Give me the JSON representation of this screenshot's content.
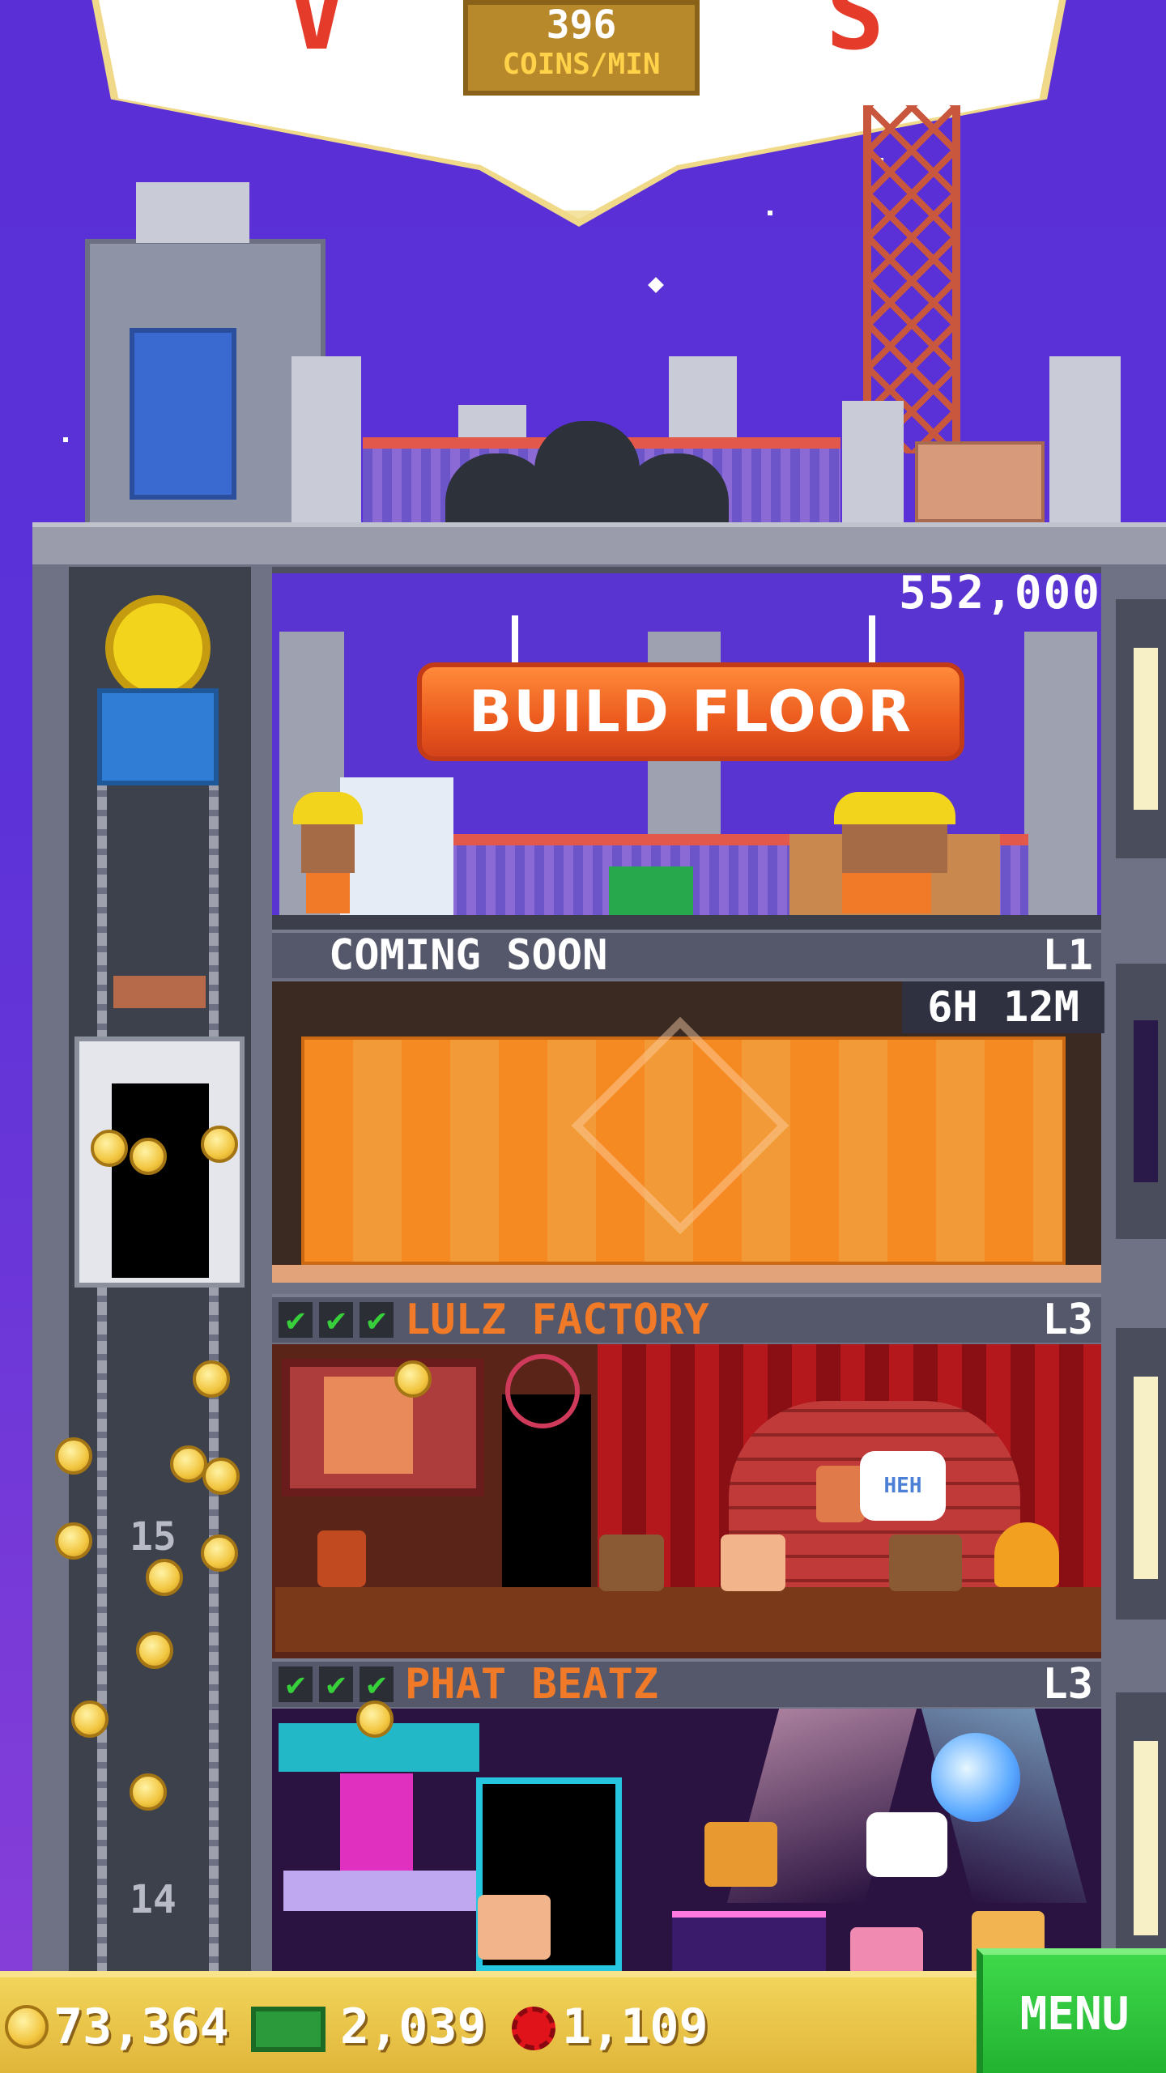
{
  "sign": {
    "coins_rate_value": "396",
    "coins_rate_unit": "COINS/MIN"
  },
  "build_floor": {
    "price": "552,000",
    "button_label": "BUILD FLOOR"
  },
  "coming_soon_floor": {
    "label": "COMING SOON",
    "level": "L1",
    "timer": "6H 12M"
  },
  "floors": [
    {
      "name": "LULZ FACTORY",
      "level": "L3",
      "checks": 3,
      "check_glyph": "✔"
    },
    {
      "name": "PHAT BEATZ",
      "level": "L3",
      "checks": 3,
      "check_glyph": "✔"
    }
  ],
  "elevator": {
    "floor_numbers": [
      "15",
      "14"
    ]
  },
  "bubble_text": "HEH",
  "bottom_bar": {
    "coins": "73,364",
    "cash": "2,039",
    "bux": "1,109",
    "menu_label": "MENU"
  },
  "colors": {
    "sky": "#5a2fd6",
    "build_button": "#ec5a1e",
    "floor_name": "#f07a27",
    "menu_button": "#22b331",
    "bottom_bar": "#e0b63a"
  },
  "icons": [
    "coin-icon",
    "cash-icon",
    "bux-icon",
    "check-icon",
    "construction-sign-icon",
    "pulley-icon"
  ]
}
